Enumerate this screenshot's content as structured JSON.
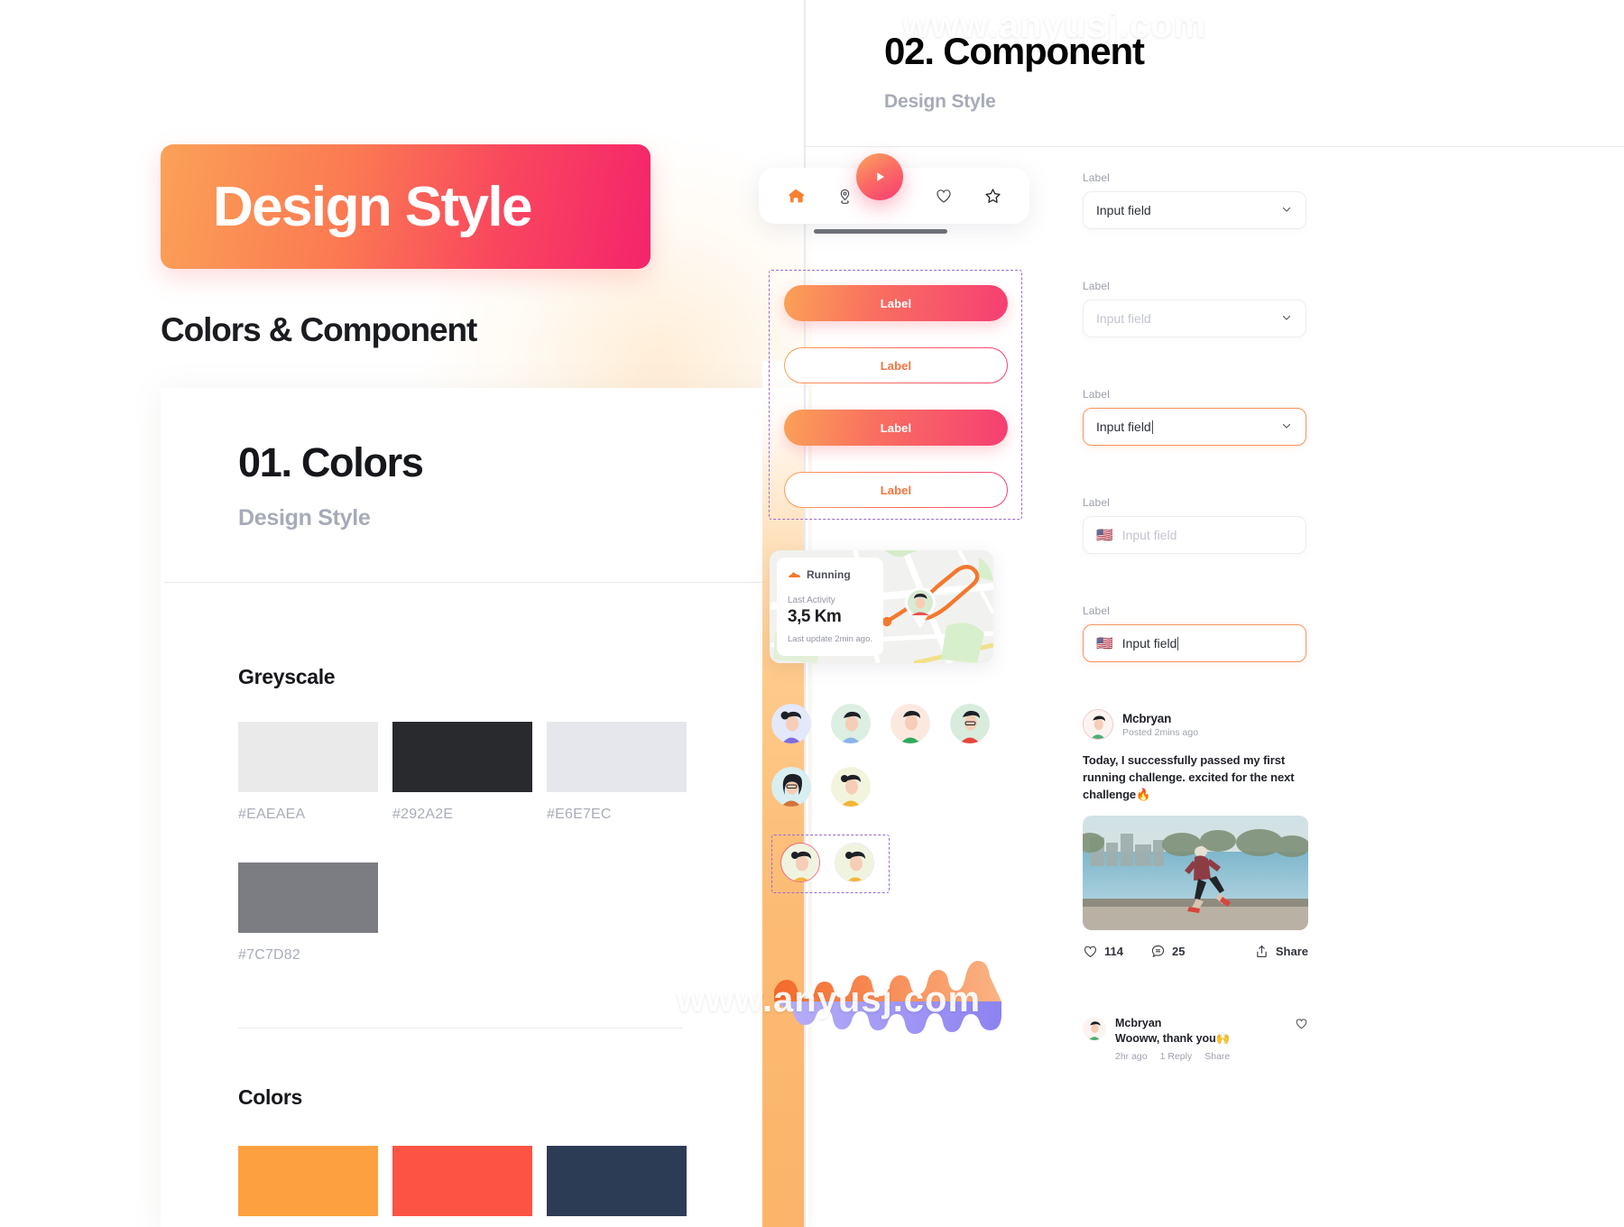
{
  "watermarks": [
    {
      "text": "www.anyusj.com"
    },
    {
      "text": "www.anyusj.com"
    }
  ],
  "left": {
    "hero_label": "Design Style",
    "section_heading": "Colors & Component",
    "sheet_title": "01. Colors",
    "sheet_subtitle": "Design Style",
    "greyscale_title": "Greyscale",
    "colors_title": "Colors",
    "greyscale": [
      {
        "hex": "#EAEAEA"
      },
      {
        "hex": "#292A2E"
      },
      {
        "hex": "#E6E7EC"
      },
      {
        "hex": "#7C7D82"
      }
    ],
    "colors": [
      {
        "hex": "#FDA140"
      },
      {
        "hex": "#FC5444"
      },
      {
        "hex": "#2C3C55"
      }
    ]
  },
  "right": {
    "title": "02. Component",
    "subtitle": "Design Style",
    "tabbar": {
      "items": [
        {
          "icon": "home-icon",
          "active": true
        },
        {
          "icon": "location-pin-icon",
          "active": false
        },
        {
          "icon": "play-icon",
          "active": false
        },
        {
          "icon": "heart-icon",
          "active": false
        },
        {
          "icon": "star-icon",
          "active": false
        }
      ]
    },
    "buttons": [
      {
        "label": "Label",
        "style": "filled"
      },
      {
        "label": "Label",
        "style": "outline"
      },
      {
        "label": "Label",
        "style": "filled"
      },
      {
        "label": "Label",
        "style": "outline"
      }
    ],
    "map_card": {
      "activity": "Running",
      "last_activity_label": "Last Activity",
      "distance": "3,5 Km",
      "update": "Last update 2min ago."
    },
    "fields": [
      {
        "label": "Label",
        "value": "Input field",
        "placeholder": "Input field",
        "state": "default",
        "control": "select",
        "flag": ""
      },
      {
        "label": "Label",
        "value": "",
        "placeholder": "Input field",
        "state": "empty",
        "control": "select",
        "flag": ""
      },
      {
        "label": "Label",
        "value": "Input field",
        "placeholder": "Input field",
        "state": "focus",
        "control": "select",
        "flag": ""
      },
      {
        "label": "Label",
        "value": "",
        "placeholder": "Input field",
        "state": "empty",
        "control": "phone",
        "flag": "🇺🇸"
      },
      {
        "label": "Label",
        "value": "Input field",
        "placeholder": "Input field",
        "state": "focus",
        "control": "phone",
        "flag": "🇺🇸"
      }
    ],
    "post": {
      "author": "Mcbryan",
      "time": "Posted 2mins ago",
      "body": "Today, I successfully passed my first running challenge. excited for the next challenge🔥",
      "likes": "114",
      "comments": "25",
      "share_label": "Share"
    },
    "comment": {
      "author": "Mcbryan",
      "text": "Wooww, thank you🙌",
      "time": "2hr ago",
      "reply": "1 Reply",
      "share": "Share"
    }
  },
  "palette": {
    "gradient_start": "#FBA157",
    "gradient_mid": "#F9705F",
    "gradient_end": "#F63E73",
    "accent_orange": "#F7733E",
    "selection_purple": "#9A6BD6",
    "wave_orange": "#F4793B",
    "wave_purple": "#8F86F0"
  }
}
